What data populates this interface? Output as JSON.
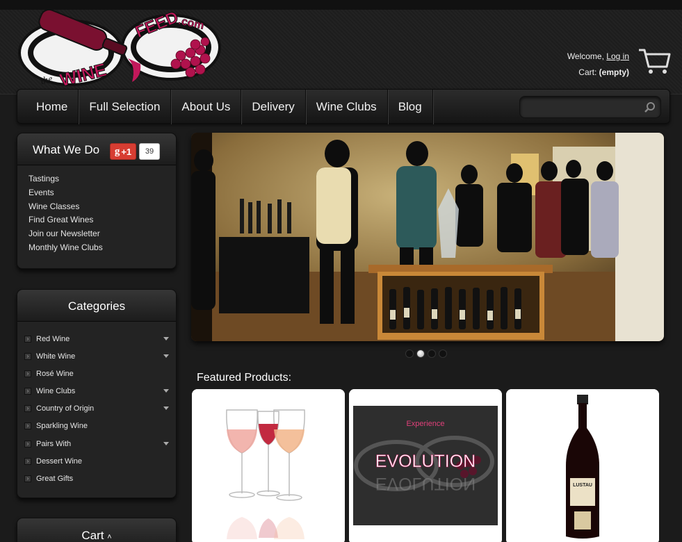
{
  "header": {
    "logo_alt": "the WINE FEED.com",
    "welcome_text": "Welcome,",
    "login_link": "Log in",
    "cart_label": "Cart:",
    "cart_status": "(empty)"
  },
  "nav": {
    "items": [
      "Home",
      "Full Selection",
      "About Us",
      "Delivery",
      "Wine Clubs",
      "Blog"
    ],
    "search_placeholder": ""
  },
  "what_we_do": {
    "title": "What We Do",
    "gplus_label": "+1",
    "gplus_count": "39",
    "items": [
      "Tastings",
      "Events",
      "Wine Classes",
      "Find Great Wines",
      "Join our Newsletter",
      "Monthly Wine Clubs"
    ]
  },
  "categories": {
    "title": "Categories",
    "items": [
      {
        "label": "Red Wine",
        "has_submenu": true
      },
      {
        "label": "White Wine",
        "has_submenu": true
      },
      {
        "label": "Rosé Wine",
        "has_submenu": false
      },
      {
        "label": "Wine Clubs",
        "has_submenu": true
      },
      {
        "label": "Country of Origin",
        "has_submenu": true
      },
      {
        "label": "Sparkling Wine",
        "has_submenu": false
      },
      {
        "label": "Pairs With",
        "has_submenu": true
      },
      {
        "label": "Dessert Wine",
        "has_submenu": false
      },
      {
        "label": "Great Gifts",
        "has_submenu": false
      }
    ]
  },
  "cart_box": {
    "title": "Cart"
  },
  "slider": {
    "slide_count": 4,
    "active_index": 1
  },
  "featured": {
    "title": "Featured Products:",
    "products": [
      {
        "name": "rose-wine-glasses"
      },
      {
        "name": "evolution-box",
        "tagline": "Experience",
        "title": "EVOLUTION"
      },
      {
        "name": "lustau-sherry-bottle",
        "brand": "LUSTAU"
      }
    ]
  },
  "colors": {
    "background": "#1b1b1b",
    "accent": "#c2185b",
    "panel": "#232323"
  }
}
